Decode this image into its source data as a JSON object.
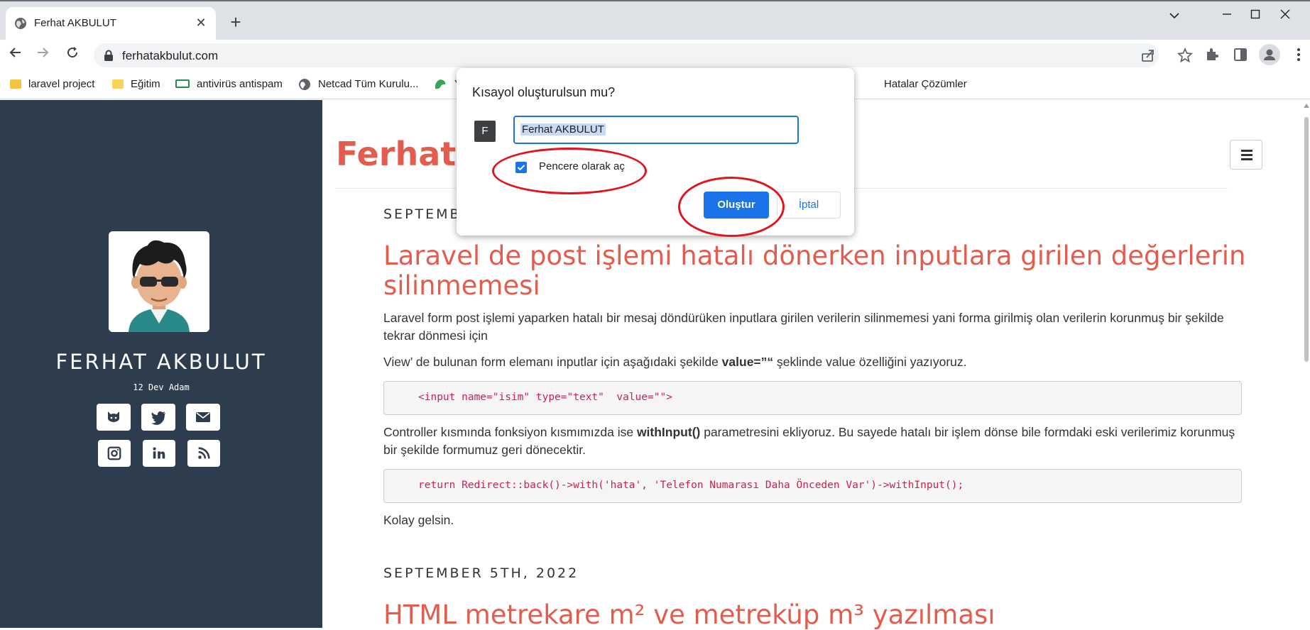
{
  "browser": {
    "tab_title": "Ferhat AKBULUT",
    "url": "ferhatakbulut.com",
    "bookmarks": [
      "laravel project",
      "Eğitim",
      "antivirüs antispam",
      "Netcad Tüm Kurulu...",
      "Y",
      "Hatalar Çözümler"
    ]
  },
  "sidebar": {
    "name": "FERHAT AKBULUT",
    "tagline": "12 Dev Adam",
    "social_icons": [
      "github-icon",
      "twitter-icon",
      "mail-icon",
      "instagram-icon",
      "linkedin-icon",
      "rss-icon"
    ]
  },
  "main": {
    "site_title": "Ferhat A",
    "posts": [
      {
        "date": "SEPTEMB",
        "title": "Laravel de post işlemi hatalı dönerken inputlara girilen değerlerin silinmemesi",
        "para1": "Laravel form post işlemi yaparken hatalı bir mesaj döndürüken inputlara girilen verilerin silinmemesi yani forma girilmiş olan verilerin korunmuş bir şekilde tekrar dönmesi için",
        "para2_pre": "View’ de bulunan form elemanı inputlar için aşağıdaki şekilde ",
        "para2_bold": "value=”“",
        "para2_post": " şeklinde value özelliğini yazıyoruz.",
        "code1": "<input name=\"isim\" type=\"text\"  value=\"\">",
        "para3_pre": "Controller kısmında fonksiyon kısmımızda ise ",
        "para3_bold": "withInput()",
        "para3_post": " parametresini ekliyoruz. Bu sayede hatalı bir işlem dönse bile formdaki eski verilerimiz korunmuş bir şekilde formumuz geri dönecektir.",
        "code2": "return Redirect::back()->with('hata', 'Telefon Numarası Daha Önceden Var')->withInput();",
        "closing": "Kolay gelsin."
      },
      {
        "date": "SEPTEMBER 5TH, 2022",
        "title": "HTML metrekare m² ve metreküp m³ yazılması"
      }
    ]
  },
  "dialog": {
    "title": "Kısayol oluşturulsun mu?",
    "app_letter": "F",
    "name_value": "Ferhat AKBULUT",
    "checkbox_label": "Pencere olarak aç",
    "checkbox_checked": true,
    "ok_label": "Oluştur",
    "cancel_label": "İptal"
  },
  "colors": {
    "accent": "#1a73e8",
    "sidebar_bg": "#2e3d4e",
    "heading": "#e25d4e",
    "annotation": "#e0141c"
  }
}
